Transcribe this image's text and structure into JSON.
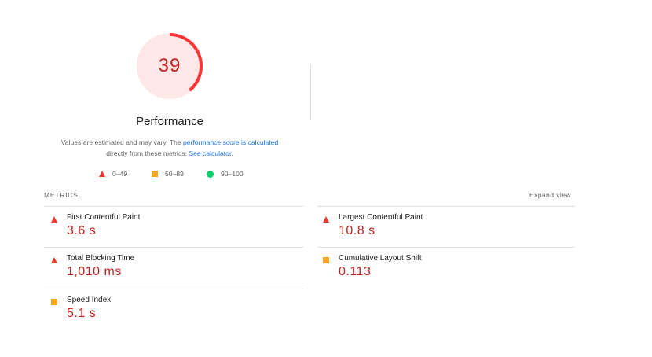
{
  "gauge": {
    "score": "39",
    "fraction": 0.39,
    "color": "#ff3333",
    "bg": "#fce8e6"
  },
  "title": "Performance",
  "description": {
    "text1": "Values are estimated and may vary. The ",
    "link1": "performance score is calculated",
    "text2": "directly from these metrics. ",
    "link2": "See calculator",
    "text3": "."
  },
  "legend": {
    "fail": {
      "label": "0–49",
      "icon": "red-triangle-icon"
    },
    "average": {
      "label": "50–89",
      "icon": "orange-square-icon"
    },
    "pass": {
      "label": "90–100",
      "icon": "green-circle-icon"
    }
  },
  "metrics_header": "METRICS",
  "expand_view": "Expand view",
  "metrics": {
    "fcp": {
      "name": "First Contentful Paint",
      "value": "3.6 s",
      "status": "fail"
    },
    "lcp": {
      "name": "Largest Contentful Paint",
      "value": "10.8 s",
      "status": "fail"
    },
    "tbt": {
      "name": "Total Blocking Time",
      "value": "1,010 ms",
      "status": "fail"
    },
    "cls": {
      "name": "Cumulative Layout Shift",
      "value": "0.113",
      "status": "average"
    },
    "si": {
      "name": "Speed Index",
      "value": "5.1 s",
      "status": "average"
    }
  },
  "colors": {
    "fail": "#eb3b2f",
    "average": "#f5a623",
    "pass": "#0cce6b",
    "value_text": "#c5221f",
    "link": "#1a73e8"
  }
}
